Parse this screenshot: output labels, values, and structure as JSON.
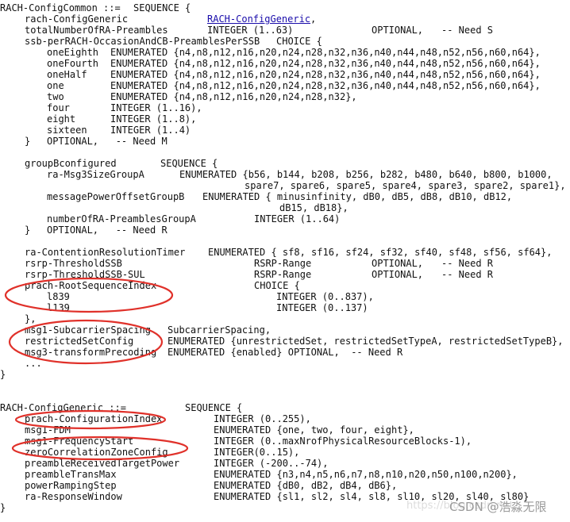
{
  "rach_config_common": [
    [
      "RACH-ConfigCommon ::=",
      "SEQUENCE {"
    ],
    [
      "rach-ConfigGeneric",
      "RACH-ConfigGeneric",
      ","
    ],
    [
      "totalNumberOfRA-Preambles",
      "INTEGER (1..63)",
      "OPTIONAL,",
      "-- Need S"
    ],
    [
      "ssb-perRACH-OccasionAndCB-PreamblesPerSSB",
      "CHOICE {"
    ],
    [
      "oneEighth",
      "ENUMERATED {n4,n8,n12,n16,n20,n24,n28,n32,n36,n40,n44,n48,n52,n56,n60,n64},"
    ],
    [
      "oneFourth",
      "ENUMERATED {n4,n8,n12,n16,n20,n24,n28,n32,n36,n40,n44,n48,n52,n56,n60,n64},"
    ],
    [
      "oneHalf",
      "ENUMERATED {n4,n8,n12,n16,n20,n24,n28,n32,n36,n40,n44,n48,n52,n56,n60,n64},"
    ],
    [
      "one",
      "ENUMERATED {n4,n8,n12,n16,n20,n24,n28,n32,n36,n40,n44,n48,n52,n56,n60,n64},"
    ],
    [
      "two",
      "ENUMERATED {n4,n8,n12,n16,n20,n24,n28,n32},"
    ],
    [
      "four",
      "INTEGER (1..16),"
    ],
    [
      "eight",
      "INTEGER (1..8),"
    ],
    [
      "sixteen",
      "INTEGER (1..4)"
    ],
    [
      "}",
      "OPTIONAL,   -- Need M"
    ],
    [
      "groupBconfigured",
      "SEQUENCE {"
    ],
    [
      "ra-Msg3SizeGroupA",
      "ENUMERATED {b56, b144, b208, b256, b282, b480, b640, b800, b1000,"
    ],
    [
      "spare7, spare6, spare5, spare4, spare3, spare2, spare1},"
    ],
    [
      "messagePowerOffsetGroupB",
      "ENUMERATED { minusinfinity, dB0, dB5, dB8, dB10, dB12,"
    ],
    [
      "dB15, dB18},"
    ],
    [
      "numberOfRA-PreamblesGroupA",
      "INTEGER (1..64)"
    ],
    [
      "}",
      "OPTIONAL,   -- Need R"
    ],
    [
      "ra-ContentionResolutionTimer",
      "ENUMERATED { sf8, sf16, sf24, sf32, sf40, sf48, sf56, sf64},"
    ],
    [
      "rsrp-ThresholdSSB",
      "RSRP-Range",
      "OPTIONAL,",
      "-- Need R"
    ],
    [
      "rsrp-ThresholdSSB-SUL",
      "RSRP-Range",
      "OPTIONAL,",
      "-- Need R"
    ],
    [
      "prach-RootSequenceIndex",
      "CHOICE {"
    ],
    [
      "l839",
      "INTEGER (0..837),"
    ],
    [
      "l139",
      "INTEGER (0..137)"
    ],
    [
      "},"
    ],
    [
      "msg1-SubcarrierSpacing",
      "SubcarrierSpacing,"
    ],
    [
      "restrictedSetConfig",
      "ENUMERATED {unrestrictedSet, restrictedSetTypeA, restrictedSetTypeB},"
    ],
    [
      "msg3-transformPrecoding",
      "ENUMERATED {enabled} OPTIONAL,  -- Need R"
    ],
    [
      "..."
    ],
    [
      "}"
    ]
  ],
  "rach_config_generic": [
    [
      "RACH-ConfigGeneric ::=",
      "SEQUENCE {"
    ],
    [
      "prach-ConfigurationIndex",
      "INTEGER (0..255),"
    ],
    [
      "msg1-FDM",
      "ENUMERATED {one, two, four, eight},"
    ],
    [
      "msg1-FrequencyStart",
      "INTEGER (0..maxNrofPhysicalResourceBlocks-1),"
    ],
    [
      "zeroCorrelationZoneConfig",
      "INTEGER(0..15),"
    ],
    [
      "preambleReceivedTargetPower",
      "INTEGER (-200..-74),"
    ],
    [
      "preambleTransMax",
      "ENUMERATED {n3,n4,n5,n6,n7,n8,n10,n20,n50,n100,n200},"
    ],
    [
      "powerRampingStep",
      "ENUMERATED {dB0, dB2, dB4, dB6},"
    ],
    [
      "ra-ResponseWindow",
      "ENUMERATED {sl1, sl2, sl4, sl8, sl10, sl20, sl40, sl80}"
    ],
    [
      "}"
    ]
  ],
  "watermark": {
    "url": "https://blog.csdn.net",
    "text": "CSDN @浩淼无限"
  },
  "colors": {
    "annotation": "#e0312a",
    "link": "#1a0dab",
    "text": "#111111"
  }
}
